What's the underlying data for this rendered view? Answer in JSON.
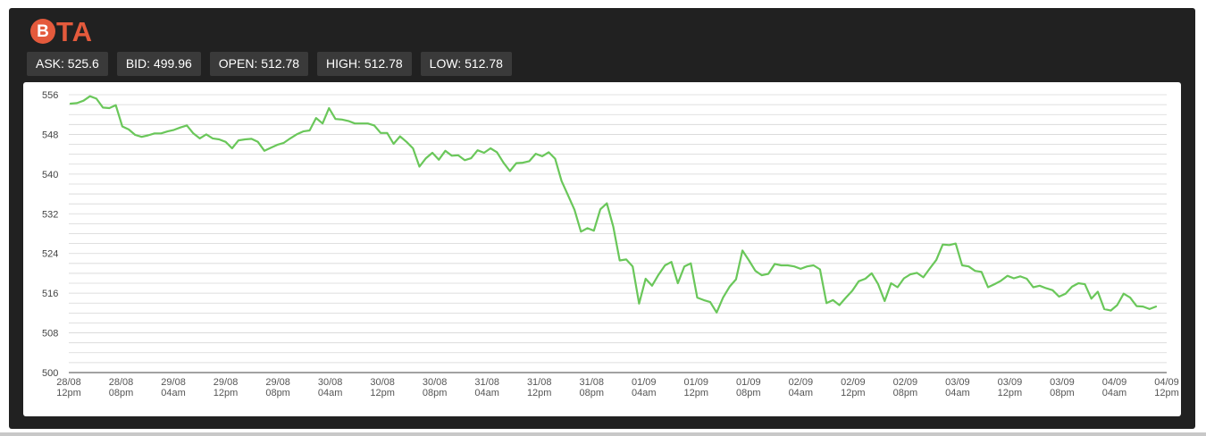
{
  "brand": {
    "coin_symbol": "B",
    "name": "TA",
    "color": "#e45a3c"
  },
  "stats": [
    {
      "text": "ASK: 525.6"
    },
    {
      "text": "BID: 499.96"
    },
    {
      "text": "OPEN: 512.78"
    },
    {
      "text": "HIGH: 512.78"
    },
    {
      "text": "LOW: 512.78"
    }
  ],
  "chart_data": {
    "type": "line",
    "line_color": "#6ac75a",
    "grid": true,
    "ylim": [
      500,
      556
    ],
    "y_ticks": [
      500,
      508,
      516,
      524,
      532,
      540,
      548,
      556
    ],
    "x_tick_labels": [
      {
        "date": "28/08",
        "time": "12pm"
      },
      {
        "date": "28/08",
        "time": "08pm"
      },
      {
        "date": "29/08",
        "time": "04am"
      },
      {
        "date": "29/08",
        "time": "12pm"
      },
      {
        "date": "29/08",
        "time": "08pm"
      },
      {
        "date": "30/08",
        "time": "04am"
      },
      {
        "date": "30/08",
        "time": "12pm"
      },
      {
        "date": "30/08",
        "time": "08pm"
      },
      {
        "date": "31/08",
        "time": "04am"
      },
      {
        "date": "31/08",
        "time": "12pm"
      },
      {
        "date": "31/08",
        "time": "08pm"
      },
      {
        "date": "01/09",
        "time": "04am"
      },
      {
        "date": "01/09",
        "time": "12pm"
      },
      {
        "date": "01/09",
        "time": "08pm"
      },
      {
        "date": "02/09",
        "time": "04am"
      },
      {
        "date": "02/09",
        "time": "12pm"
      },
      {
        "date": "02/09",
        "time": "08pm"
      },
      {
        "date": "03/09",
        "time": "04am"
      },
      {
        "date": "03/09",
        "time": "12pm"
      },
      {
        "date": "03/09",
        "time": "08pm"
      },
      {
        "date": "04/09",
        "time": "04am"
      },
      {
        "date": "04/09",
        "time": "12pm"
      }
    ],
    "series": [
      {
        "values": [
          554.2,
          554.3,
          554.8,
          555.7,
          555.2,
          553.4,
          553.3,
          553.9,
          549.6,
          549.0,
          547.9,
          547.5,
          547.8,
          548.2,
          548.2,
          548.6,
          548.9,
          549.4,
          549.8,
          548.2,
          547.2,
          548.0,
          547.2,
          547.0,
          546.5,
          545.2,
          546.8,
          547.0,
          547.1,
          546.5,
          544.7,
          545.3,
          545.9,
          546.3,
          547.2,
          548.0,
          548.6,
          548.8,
          551.3,
          550.2,
          553.3,
          551.1,
          551.0,
          550.7,
          550.2,
          550.2,
          550.2,
          549.8,
          548.3,
          548.3,
          546.1,
          547.6,
          546.5,
          545.2,
          541.5,
          543.2,
          544.3,
          542.9,
          544.7,
          543.7,
          543.8,
          542.8,
          543.2,
          544.8,
          544.3,
          545.2,
          544.4,
          542.3,
          540.6,
          542.2,
          542.3,
          542.6,
          544.1,
          543.6,
          544.4,
          543.1,
          538.6,
          535.7,
          532.8,
          528.4,
          529.1,
          528.6,
          532.9,
          534.1,
          529.4,
          522.6,
          522.8,
          521.4,
          513.9,
          518.9,
          517.5,
          519.7,
          521.6,
          522.3,
          518.0,
          521.4,
          522.0,
          515.1,
          514.6,
          514.2,
          512.1,
          515.1,
          517.3,
          518.8,
          524.6,
          522.6,
          520.5,
          519.6,
          519.9,
          521.9,
          521.6,
          521.6,
          521.4,
          520.9,
          521.4,
          521.6,
          520.8,
          514.0,
          514.6,
          513.6,
          515.1,
          516.5,
          518.4,
          518.9,
          520.0,
          517.8,
          514.4,
          518.0,
          517.2,
          519.0,
          519.8,
          520.1,
          519.2,
          521.0,
          522.7,
          525.8,
          525.7,
          526.0,
          521.6,
          521.4,
          520.5,
          520.3,
          517.2,
          517.8,
          518.5,
          519.5,
          519.0,
          519.4,
          518.9,
          517.2,
          517.5,
          517.0,
          516.6,
          515.3,
          515.9,
          517.3,
          518.0,
          517.8,
          514.9,
          516.3,
          512.8,
          512.5,
          513.6,
          515.9,
          515.1,
          513.4,
          513.3,
          512.8,
          513.3
        ]
      }
    ]
  }
}
